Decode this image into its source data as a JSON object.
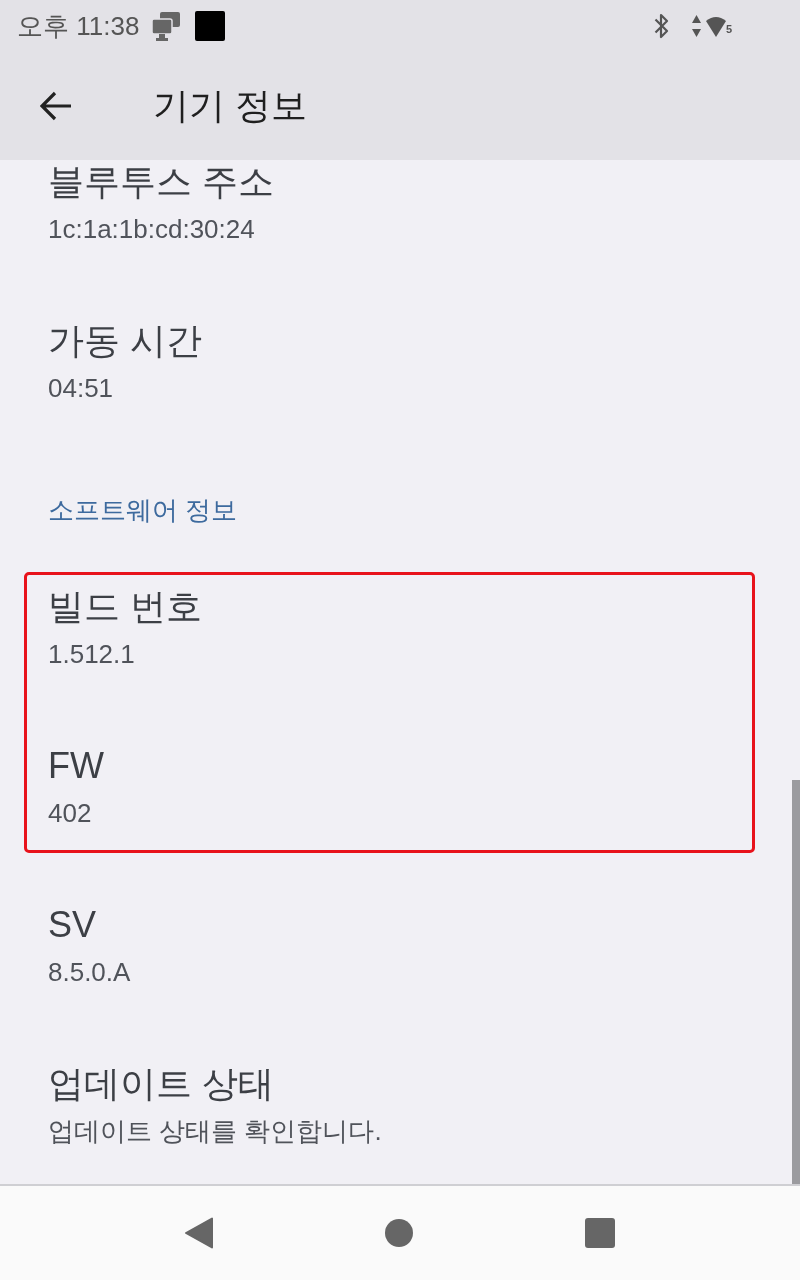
{
  "status_bar": {
    "time": "오후 11:38",
    "wifi_badge": "5"
  },
  "app_bar": {
    "title": "기기 정보"
  },
  "list": [
    {
      "kind": "item",
      "title": "블루투스 주소",
      "summary": "1c:1a:1b:cd:30:24",
      "highlighted": false
    },
    {
      "kind": "item",
      "title": "가동 시간",
      "summary": "04:51",
      "highlighted": false
    },
    {
      "kind": "header",
      "title": "소프트웨어 정보"
    },
    {
      "kind": "item",
      "title": "빌드 번호",
      "summary": "1.512.1",
      "highlighted": true
    },
    {
      "kind": "item",
      "title": "FW",
      "summary": "402",
      "highlighted": true
    },
    {
      "kind": "item",
      "title": "SV",
      "summary": "8.5.0.A",
      "highlighted": false
    },
    {
      "kind": "item",
      "title": "업데이트 상태",
      "summary": "업데이트 상태를 확인합니다.",
      "highlighted": false
    }
  ]
}
